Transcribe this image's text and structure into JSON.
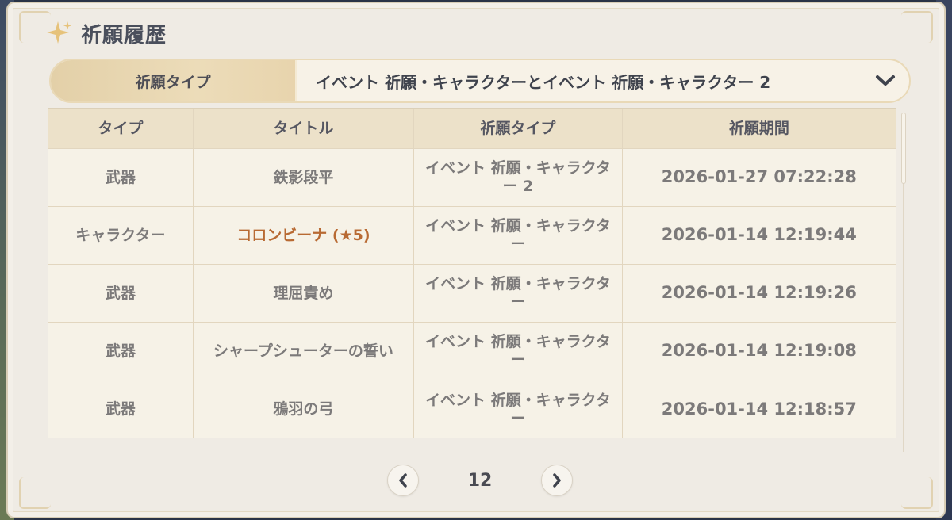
{
  "header": {
    "title": "祈願履歴"
  },
  "filter": {
    "label": "祈願タイプ",
    "value": "イベント 祈願・キャラクターとイベント 祈願・キャラクター 2"
  },
  "table": {
    "columns": [
      "タイプ",
      "タイトル",
      "祈願タイプ",
      "祈願期間"
    ],
    "rows": [
      {
        "type": "武器",
        "title": "鉄影段平",
        "wish": "イベント 祈願・キャラクター 2",
        "time": "2026-01-27 07:22:28"
      },
      {
        "type": "キャラクター",
        "title": "コロンビーナ (★5)",
        "wish": "イベント 祈願・キャラクター",
        "time": "2026-01-14 12:19:44"
      },
      {
        "type": "武器",
        "title": "理屈責め",
        "wish": "イベント 祈願・キャラクター",
        "time": "2026-01-14 12:19:26"
      },
      {
        "type": "武器",
        "title": "シャープシューターの誓い",
        "wish": "イベント 祈願・キャラクター",
        "time": "2026-01-14 12:19:08"
      },
      {
        "type": "武器",
        "title": "鴉羽の弓",
        "wish": "イベント 祈願・キャラクター",
        "time": "2026-01-14 12:18:57"
      }
    ]
  },
  "pager": {
    "page": "12"
  },
  "icons": {
    "star": "sparkle-star-icon",
    "dropdown": "chevron-down-icon",
    "prev": "chevron-left-icon",
    "next": "chevron-right-icon"
  },
  "colors": {
    "five_star": "#b86a33",
    "panel": "#efebe4",
    "header_row": "#ece1c9"
  }
}
